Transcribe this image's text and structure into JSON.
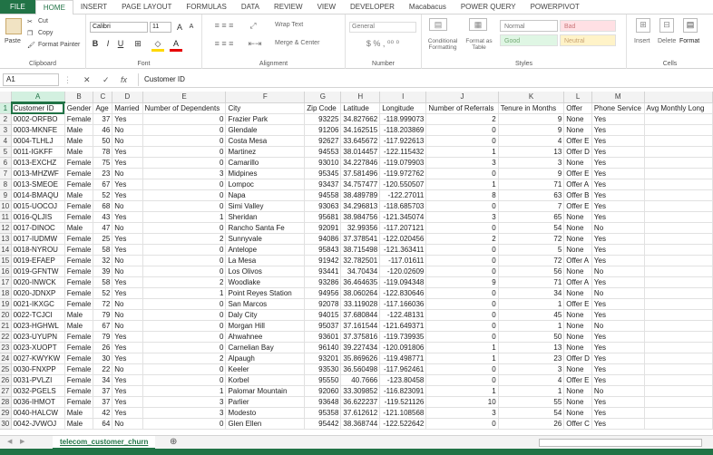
{
  "ribbon_tabs": [
    "FILE",
    "HOME",
    "INSERT",
    "PAGE LAYOUT",
    "FORMULAS",
    "DATA",
    "REVIEW",
    "VIEW",
    "DEVELOPER",
    "Macabacus",
    "POWER QUERY",
    "POWERPIVOT"
  ],
  "clipboard": {
    "paste": "Paste",
    "cut": "Cut",
    "copy": "Copy",
    "format_painter": "Format Painter",
    "label": "Clipboard"
  },
  "font": {
    "name": "Calibri",
    "size": "11",
    "label": "Font"
  },
  "alignment": {
    "wrap": "Wrap Text",
    "merge": "Merge & Center",
    "label": "Alignment"
  },
  "number": {
    "format": "General",
    "label": "Number"
  },
  "styles": {
    "conditional": "Conditional Formatting",
    "format_table": "Format as Table",
    "normal": "Normal",
    "bad": "Bad",
    "good": "Good",
    "neutral": "Neutral",
    "label": "Styles"
  },
  "cells": {
    "insert": "Insert",
    "delete": "Delete",
    "format": "Format",
    "label": "Cells"
  },
  "formula_bar": {
    "name_box": "A1",
    "content": "Customer ID"
  },
  "columns": [
    "A",
    "B",
    "C",
    "D",
    "E",
    "F",
    "G",
    "H",
    "I",
    "J",
    "K",
    "L",
    "M",
    ""
  ],
  "headers": [
    "Customer ID",
    "Gender",
    "Age",
    "Married",
    "Number of Dependents",
    "City",
    "Zip Code",
    "Latitude",
    "Longitude",
    "Number of Referrals",
    "Tenure in Months",
    "Offer",
    "Phone Service",
    "Avg Monthly Long"
  ],
  "rows": [
    [
      "0002-ORFBO",
      "Female",
      "37",
      "Yes",
      "0",
      "Frazier Park",
      "93225",
      "34.827662",
      "-118.999073",
      "2",
      "9",
      "None",
      "Yes"
    ],
    [
      "0003-MKNFE",
      "Male",
      "46",
      "No",
      "0",
      "Glendale",
      "91206",
      "34.162515",
      "-118.203869",
      "0",
      "9",
      "None",
      "Yes"
    ],
    [
      "0004-TLHLJ",
      "Male",
      "50",
      "No",
      "0",
      "Costa Mesa",
      "92627",
      "33.645672",
      "-117.922613",
      "0",
      "4",
      "Offer E",
      "Yes"
    ],
    [
      "0011-IGKFF",
      "Male",
      "78",
      "Yes",
      "0",
      "Martinez",
      "94553",
      "38.014457",
      "-122.115432",
      "1",
      "13",
      "Offer D",
      "Yes"
    ],
    [
      "0013-EXCHZ",
      "Female",
      "75",
      "Yes",
      "0",
      "Camarillo",
      "93010",
      "34.227846",
      "-119.079903",
      "3",
      "3",
      "None",
      "Yes"
    ],
    [
      "0013-MHZWF",
      "Female",
      "23",
      "No",
      "3",
      "Midpines",
      "95345",
      "37.581496",
      "-119.972762",
      "0",
      "9",
      "Offer E",
      "Yes"
    ],
    [
      "0013-SMEOE",
      "Female",
      "67",
      "Yes",
      "0",
      "Lompoc",
      "93437",
      "34.757477",
      "-120.550507",
      "1",
      "71",
      "Offer A",
      "Yes"
    ],
    [
      "0014-BMAQU",
      "Male",
      "52",
      "Yes",
      "0",
      "Napa",
      "94558",
      "38.489789",
      "-122.27011",
      "8",
      "63",
      "Offer B",
      "Yes"
    ],
    [
      "0015-UOCOJ",
      "Female",
      "68",
      "No",
      "0",
      "Simi Valley",
      "93063",
      "34.296813",
      "-118.685703",
      "0",
      "7",
      "Offer E",
      "Yes"
    ],
    [
      "0016-QLJIS",
      "Female",
      "43",
      "Yes",
      "1",
      "Sheridan",
      "95681",
      "38.984756",
      "-121.345074",
      "3",
      "65",
      "None",
      "Yes"
    ],
    [
      "0017-DINOC",
      "Male",
      "47",
      "No",
      "0",
      "Rancho Santa Fe",
      "92091",
      "32.99356",
      "-117.207121",
      "0",
      "54",
      "None",
      "No"
    ],
    [
      "0017-IUDMW",
      "Female",
      "25",
      "Yes",
      "2",
      "Sunnyvale",
      "94086",
      "37.378541",
      "-122.020456",
      "2",
      "72",
      "None",
      "Yes"
    ],
    [
      "0018-NYROU",
      "Female",
      "58",
      "Yes",
      "0",
      "Antelope",
      "95843",
      "38.715498",
      "-121.363411",
      "0",
      "5",
      "None",
      "Yes"
    ],
    [
      "0019-EFAEP",
      "Female",
      "32",
      "No",
      "0",
      "La Mesa",
      "91942",
      "32.782501",
      "-117.01611",
      "0",
      "72",
      "Offer A",
      "Yes"
    ],
    [
      "0019-GFNTW",
      "Female",
      "39",
      "No",
      "0",
      "Los Olivos",
      "93441",
      "34.70434",
      "-120.02609",
      "0",
      "56",
      "None",
      "No"
    ],
    [
      "0020-INWCK",
      "Female",
      "58",
      "Yes",
      "2",
      "Woodlake",
      "93286",
      "36.464635",
      "-119.094348",
      "9",
      "71",
      "Offer A",
      "Yes"
    ],
    [
      "0020-JDNXP",
      "Female",
      "52",
      "Yes",
      "1",
      "Point Reyes Station",
      "94956",
      "38.060264",
      "-122.830646",
      "0",
      "34",
      "None",
      "No"
    ],
    [
      "0021-IKXGC",
      "Female",
      "72",
      "No",
      "0",
      "San Marcos",
      "92078",
      "33.119028",
      "-117.166036",
      "0",
      "1",
      "Offer E",
      "Yes"
    ],
    [
      "0022-TCJCI",
      "Male",
      "79",
      "No",
      "0",
      "Daly City",
      "94015",
      "37.680844",
      "-122.48131",
      "0",
      "45",
      "None",
      "Yes"
    ],
    [
      "0023-HGHWL",
      "Male",
      "67",
      "No",
      "0",
      "Morgan Hill",
      "95037",
      "37.161544",
      "-121.649371",
      "0",
      "1",
      "None",
      "No"
    ],
    [
      "0023-UYUPN",
      "Female",
      "79",
      "Yes",
      "0",
      "Ahwahnee",
      "93601",
      "37.375816",
      "-119.739935",
      "0",
      "50",
      "None",
      "Yes"
    ],
    [
      "0023-XUOPT",
      "Female",
      "26",
      "Yes",
      "0",
      "Carnelian Bay",
      "96140",
      "39.227434",
      "-120.091806",
      "1",
      "13",
      "None",
      "Yes"
    ],
    [
      "0027-KWYKW",
      "Female",
      "30",
      "Yes",
      "2",
      "Alpaugh",
      "93201",
      "35.869626",
      "-119.498771",
      "1",
      "23",
      "Offer D",
      "Yes"
    ],
    [
      "0030-FNXPP",
      "Female",
      "22",
      "No",
      "0",
      "Keeler",
      "93530",
      "36.560498",
      "-117.962461",
      "0",
      "3",
      "None",
      "Yes"
    ],
    [
      "0031-PVLZI",
      "Female",
      "34",
      "Yes",
      "0",
      "Korbel",
      "95550",
      "40.7666",
      "-123.80458",
      "0",
      "4",
      "Offer E",
      "Yes"
    ],
    [
      "0032-PGELS",
      "Female",
      "37",
      "Yes",
      "1",
      "Palomar Mountain",
      "92060",
      "33.309852",
      "-116.823091",
      "1",
      "1",
      "None",
      "No"
    ],
    [
      "0036-IHMOT",
      "Female",
      "37",
      "Yes",
      "3",
      "Parlier",
      "93648",
      "36.622237",
      "-119.521126",
      "10",
      "55",
      "None",
      "Yes"
    ],
    [
      "0040-HALCW",
      "Male",
      "42",
      "Yes",
      "3",
      "Modesto",
      "95358",
      "37.612612",
      "-121.108568",
      "3",
      "54",
      "None",
      "Yes"
    ],
    [
      "0042-JVWOJ",
      "Male",
      "64",
      "No",
      "0",
      "Glen Ellen",
      "95442",
      "38.368744",
      "-122.522642",
      "0",
      "26",
      "Offer C",
      "Yes"
    ]
  ],
  "sheet_tab": "telecom_customer_churn"
}
